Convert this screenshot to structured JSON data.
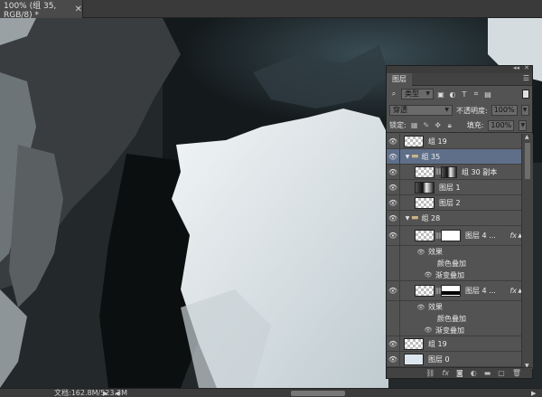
{
  "document": {
    "tab_title": "100% (组 35, RGB/8) *",
    "close_glyph": "✕"
  },
  "status_bar": {
    "info": "文档:162.8M/523.3M"
  },
  "layers_panel": {
    "tab_label": "图层",
    "filter_kind": "类型",
    "blend_mode": "穿透",
    "opacity_label": "不透明度:",
    "opacity_value": "100%",
    "lock_label": "锁定:",
    "fill_label": "填充:",
    "fill_value": "100%",
    "layers": [
      {
        "name": "组 19",
        "kind": "layer",
        "thumb": "checker"
      },
      {
        "name": "组 35",
        "kind": "group",
        "expanded": true,
        "selected": true
      },
      {
        "name": "组 30 副本",
        "kind": "layer",
        "thumb": "dark",
        "indent": 1
      },
      {
        "name": "图层 1",
        "kind": "layer",
        "thumb": "dark",
        "indent": 1
      },
      {
        "name": "图层 2",
        "kind": "layer",
        "thumb": "checker",
        "indent": 1
      },
      {
        "name": "组 28",
        "kind": "group",
        "expanded": true
      },
      {
        "name": "图层 4 ...",
        "kind": "layer",
        "thumb": "checker",
        "mask": "white",
        "fx": true,
        "indent": 1
      },
      {
        "name": "效果",
        "kind": "effect-header"
      },
      {
        "name": "颜色叠加",
        "kind": "effect"
      },
      {
        "name": "渐变叠加",
        "kind": "effect",
        "visible": true
      },
      {
        "name": "图层 4 ...",
        "kind": "layer",
        "thumb": "checker",
        "mask": "black-band",
        "fx": true,
        "indent": 1
      },
      {
        "name": "效果",
        "kind": "effect-header"
      },
      {
        "name": "颜色叠加",
        "kind": "effect"
      },
      {
        "name": "渐变叠加",
        "kind": "effect",
        "visible": true
      },
      {
        "name": "组 19",
        "kind": "layer",
        "thumb": "checker"
      },
      {
        "name": "图层 0",
        "kind": "layer",
        "thumb": "blue"
      }
    ]
  },
  "colors": {
    "panel_bg": "#535353",
    "selected_row": "#5f6f8a",
    "canvas_dark": "#1b1f20",
    "canvas_light": "#dfe6ea"
  }
}
